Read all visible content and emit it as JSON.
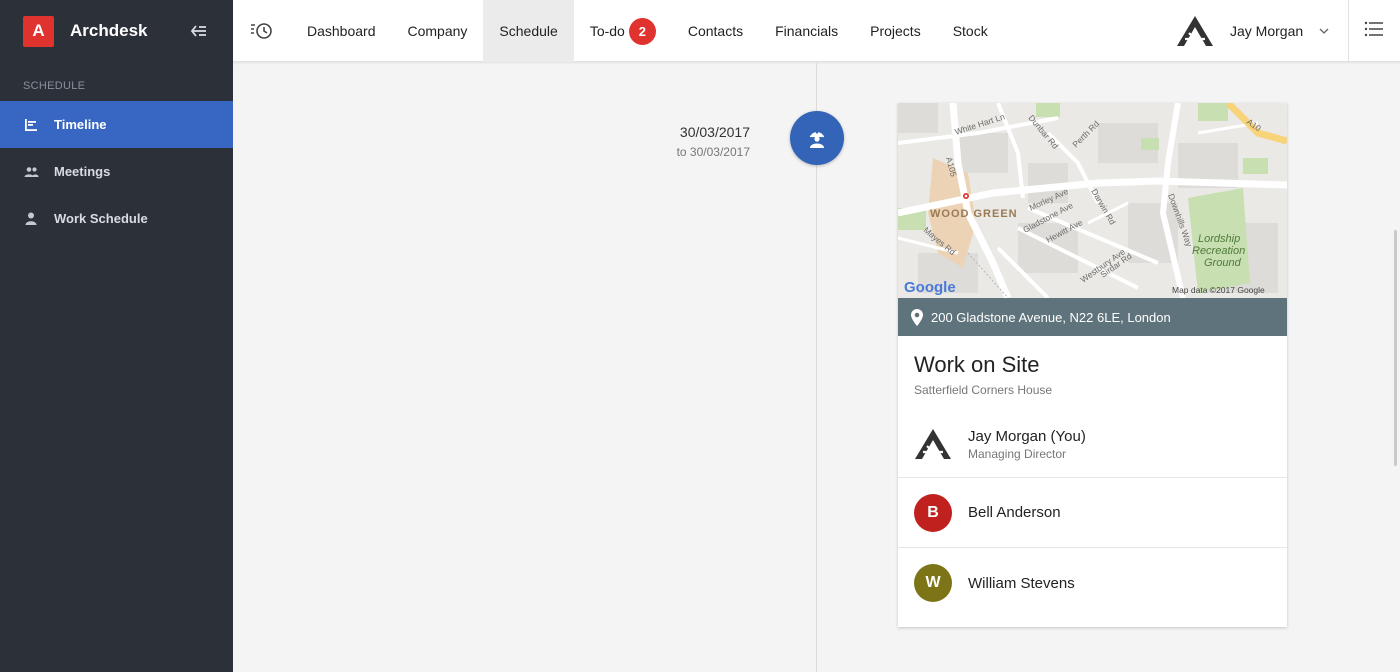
{
  "app": {
    "logo_letter": "A",
    "name": "Archdesk",
    "logo_color": "#e0322f"
  },
  "sidebar": {
    "section_label": "SCHEDULE",
    "items": [
      {
        "label": "Timeline",
        "icon": "timeline-icon",
        "active": true
      },
      {
        "label": "Meetings",
        "icon": "people-icon",
        "active": false
      },
      {
        "label": "Work Schedule",
        "icon": "person-icon",
        "active": false
      }
    ]
  },
  "topnav": {
    "items": [
      {
        "label": "Dashboard"
      },
      {
        "label": "Company"
      },
      {
        "label": "Schedule",
        "active": true
      },
      {
        "label": "To-do",
        "badge": "2"
      },
      {
        "label": "Contacts"
      },
      {
        "label": "Financials"
      },
      {
        "label": "Projects"
      },
      {
        "label": "Stock"
      }
    ],
    "user_name": "Jay Morgan"
  },
  "event": {
    "date": "30/03/2017",
    "date_to": "to 30/03/2017",
    "icon": "worker-icon",
    "map": {
      "labels": [
        "White Hart Ln",
        "Dunbar Rd",
        "Perth Rd",
        "A10",
        "A105",
        "WOOD GREEN",
        "Morley Ave",
        "Gladstone Ave",
        "Hewitt Ave",
        "Darwin Rd",
        "Mayes Rd",
        "Westbury Ave",
        "Sirdar Rd",
        "Downhills Way",
        "Lordship",
        "Recreation",
        "Ground"
      ],
      "attribution": "Map data ©2017 Google",
      "google_logo": "Google"
    },
    "address": "200 Gladstone Avenue, N22 6LE, London",
    "title": "Work on Site",
    "subtitle": "Satterfield Corners House",
    "owner": {
      "name": "Jay Morgan (You)",
      "role": "Managing Director"
    },
    "attendees": [
      {
        "initial": "B",
        "name": "Bell Anderson",
        "color": "#c0211f"
      },
      {
        "initial": "W",
        "name": "William Stevens",
        "color": "#7d7317"
      }
    ]
  },
  "colors": {
    "accent": "#3767c2",
    "sidebar_bg": "#2c3038",
    "address_bar": "#5f737c"
  }
}
